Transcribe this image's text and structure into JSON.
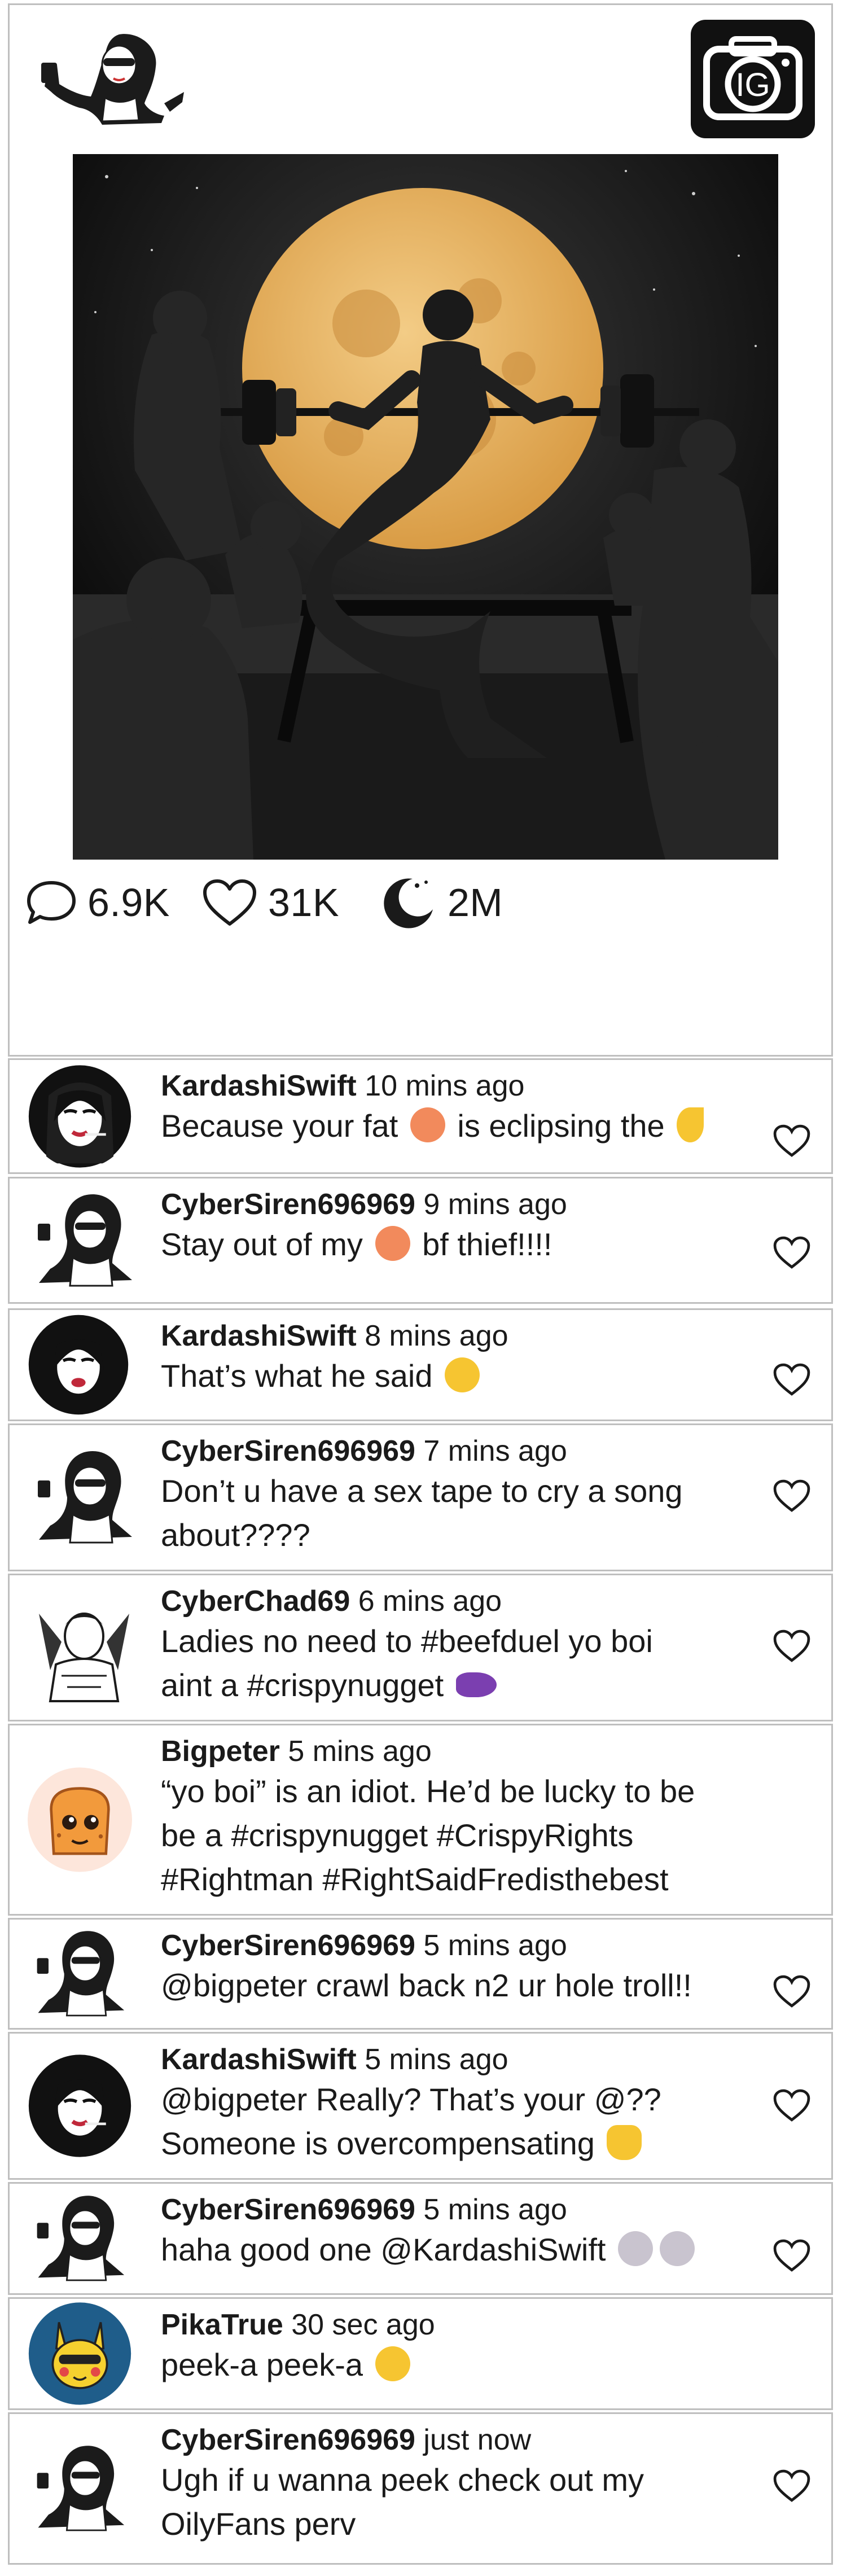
{
  "post": {
    "stats": {
      "comments": "6.9K",
      "likes": "31K",
      "shares": "2M"
    },
    "icons": [
      "selfie-avatar",
      "ig-camera-icon",
      "comment-bubble-icon",
      "heart-icon",
      "moon-share-icon"
    ]
  },
  "comments": [
    {
      "user": "KardashiSwift",
      "time": "10 mins ago",
      "text": "Because your fat",
      "emoji_after": "peach",
      "text2": "is eclipsing the",
      "emoji_end": "crescent-moon"
    },
    {
      "user": "CyberSiren696969",
      "time": "9 mins ago",
      "text": "Stay out of my",
      "emoji_after": "peach",
      "text2": "bf thief!!!!"
    },
    {
      "user": "KardashiSwift",
      "time": "8 mins ago",
      "text": "That’s what he said",
      "emoji_after": "face-with-tongue"
    },
    {
      "user": "CyberSiren696969",
      "time": "7 mins ago",
      "text": "Don’t u have a sex tape to cry a song\nabout????"
    },
    {
      "user": "CyberChad69",
      "time": "6 mins ago",
      "text": "Ladies no need to #beefduel yo boi\naint a #crispynugget",
      "emoji_after": "eggplant"
    },
    {
      "user": "Bigpeter",
      "time": "5 mins ago",
      "text": "“yo boi” is an idiot. He’d be lucky to be\n be a #crispynugget #CrispyRights\n #Rightman #RightSaidFredisthebest"
    },
    {
      "user": "CyberSiren696969",
      "time": "5 mins ago",
      "text": "@bigpeter crawl back n2 ur hole troll!!"
    },
    {
      "user": "KardashiSwift",
      "time": "5 mins ago",
      "text": "@bigpeter Really? That’s your @??\nSomeone is overcompensating",
      "emoji_after": "hand"
    },
    {
      "user": "CyberSiren696969",
      "time": "5 mins ago",
      "text": "haha good one @KardashiSwift",
      "emoji_after": "skull-skull"
    },
    {
      "user": "PikaTrue",
      "time": "30 sec ago",
      "text": "peek-a peek-a",
      "emoji_after": "face-with-tongue"
    },
    {
      "user": "CyberSiren696969",
      "time": "just now",
      "text": "Ugh if u wanna peek check out my\nOilyFans perv"
    }
  ],
  "colors": {
    "border": "#bfbfbf",
    "moon": "#e8b86a",
    "peach": "#f28a5c",
    "emoji_yellow": "#f6c531",
    "eggplant": "#7b3fb0",
    "skull": "#c9c4cf"
  }
}
